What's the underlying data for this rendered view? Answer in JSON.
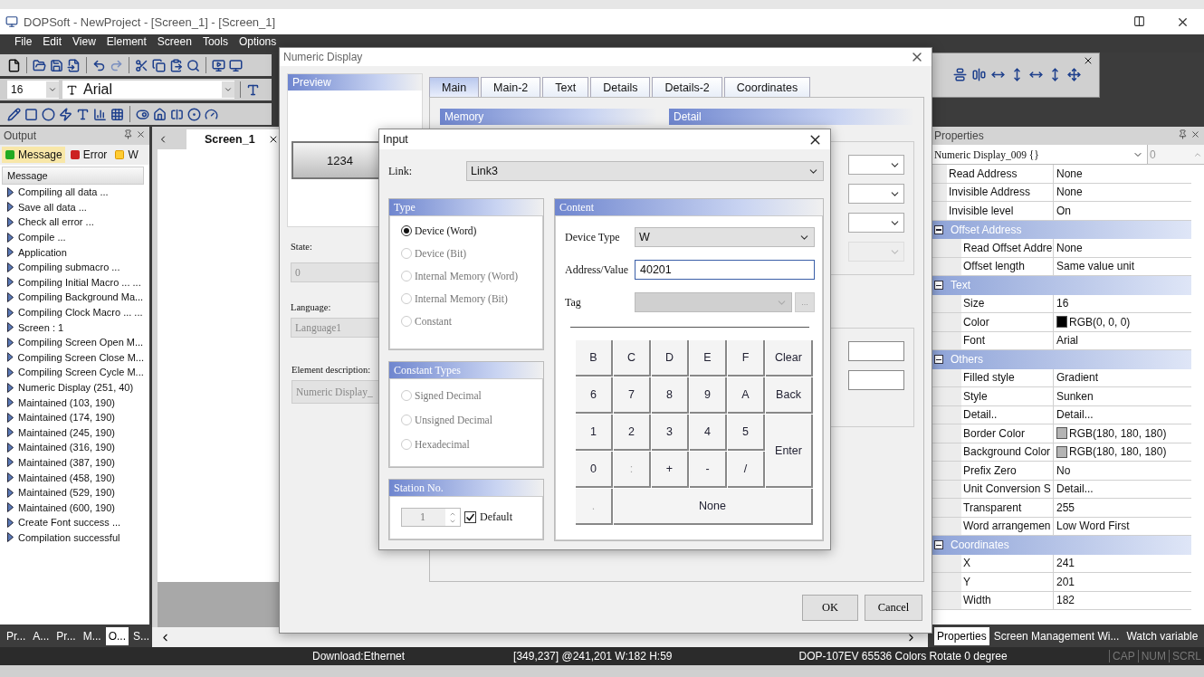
{
  "window": {
    "title": "DOPSoft - NewProject - [Screen_1] - [Screen_1]"
  },
  "menu": [
    "File",
    "Edit",
    "View",
    "Element",
    "Screen",
    "Tools",
    "Options"
  ],
  "font_toolbar": {
    "size": "16",
    "font": "Arial"
  },
  "output_panel": {
    "title": "Output",
    "tabs": [
      {
        "label": "Message",
        "selected": true
      },
      {
        "label": "Error",
        "selected": false
      },
      {
        "label": "W",
        "selected": false
      }
    ],
    "column": "Message",
    "messages": [
      "Compiling all data ...",
      "Save all data ...",
      "Check all error ...",
      "Compile ...",
      "Application",
      "Compiling submacro ...",
      "Compiling Initial Macro ... ...",
      "Compiling Background Ma...",
      "Compiling Clock Macro ... ...",
      "Screen : 1",
      "Compiling Screen Open M...",
      "Compiling Screen Close M...",
      "Compiling Screen Cycle M...",
      "Numeric Display (251, 40)",
      "Maintained (103, 190)",
      "Maintained (174, 190)",
      "Maintained (245, 190)",
      "Maintained (316, 190)",
      "Maintained (387, 190)",
      "Maintained (458, 190)",
      "Maintained (529, 190)",
      "Maintained (600, 190)",
      "Create Font success ...",
      "Compilation successful"
    ]
  },
  "left_tabs": [
    {
      "label": "Pr...",
      "selected": false
    },
    {
      "label": "A...",
      "selected": false
    },
    {
      "label": "Pr...",
      "selected": false
    },
    {
      "label": "M...",
      "selected": false
    },
    {
      "label": "O...",
      "selected": true
    },
    {
      "label": "S...",
      "selected": false
    }
  ],
  "editor": {
    "tab": "Screen_1"
  },
  "numeric_display_dialog": {
    "title": "Numeric Display",
    "preview_title": "Preview",
    "preview_value": "1234",
    "state": {
      "label": "State:",
      "value": "0",
      "disabled": true
    },
    "language": {
      "label": "Language:",
      "value": "Language1",
      "disabled": true
    },
    "description": {
      "label": "Element description:",
      "value": "Numeric Display_",
      "disabled": true
    },
    "tabs": [
      {
        "label": "Main",
        "selected": true
      },
      {
        "label": "Main-2",
        "selected": false
      },
      {
        "label": "Text",
        "selected": false
      },
      {
        "label": "Details",
        "selected": false
      },
      {
        "label": "Details-2",
        "selected": false
      },
      {
        "label": "Coordinates",
        "selected": false
      }
    ],
    "memory_title": "Memory",
    "detail_title": "Detail",
    "buttons": [
      "OK",
      "Cancel"
    ]
  },
  "input_dialog": {
    "title": "Input",
    "link": {
      "label": "Link:",
      "value": "Link3"
    },
    "type": {
      "title": "Type",
      "options": [
        {
          "label": "Device (Word)",
          "selected": true,
          "disabled": false
        },
        {
          "label": "Device (Bit)",
          "selected": false,
          "disabled": true
        },
        {
          "label": "Internal Memory (Word)",
          "selected": false,
          "disabled": true
        },
        {
          "label": "Internal Memory (Bit)",
          "selected": false,
          "disabled": true
        },
        {
          "label": "Constant",
          "selected": false,
          "disabled": true
        }
      ]
    },
    "constant_types": {
      "title": "Constant Types",
      "options": [
        {
          "label": "Signed Decimal",
          "selected": false,
          "disabled": true
        },
        {
          "label": "Unsigned Decimal",
          "selected": false,
          "disabled": true
        },
        {
          "label": "Hexadecimal",
          "selected": false,
          "disabled": true
        }
      ]
    },
    "station": {
      "title": "Station No.",
      "value": "1",
      "disabled": true,
      "default_label": "Default",
      "default_checked": true
    },
    "content": {
      "title": "Content",
      "device_type": {
        "label": "Device Type",
        "value": "W"
      },
      "address": {
        "label": "Address/Value",
        "value": "40201"
      },
      "tag": {
        "label": "Tag",
        "disabled": true,
        "browse": "..."
      },
      "keys": [
        {
          "label": "B",
          "kind": "normal",
          "disabled": false
        },
        {
          "label": "C",
          "kind": "normal",
          "disabled": false
        },
        {
          "label": "D",
          "kind": "normal",
          "disabled": false
        },
        {
          "label": "E",
          "kind": "normal",
          "disabled": false
        },
        {
          "label": "F",
          "kind": "normal",
          "disabled": false
        },
        {
          "label": "Clear",
          "kind": "normal",
          "disabled": false
        },
        {
          "label": "6",
          "kind": "normal",
          "disabled": false
        },
        {
          "label": "7",
          "kind": "normal",
          "disabled": false
        },
        {
          "label": "8",
          "kind": "normal",
          "disabled": false
        },
        {
          "label": "9",
          "kind": "normal",
          "disabled": false
        },
        {
          "label": "A",
          "kind": "normal",
          "disabled": false
        },
        {
          "label": "Back",
          "kind": "normal",
          "disabled": false
        },
        {
          "label": "1",
          "kind": "normal",
          "disabled": false
        },
        {
          "label": "2",
          "kind": "normal",
          "disabled": false
        },
        {
          "label": "3",
          "kind": "normal",
          "disabled": false
        },
        {
          "label": "4",
          "kind": "normal",
          "disabled": false
        },
        {
          "label": "5",
          "kind": "normal",
          "disabled": false
        },
        {
          "label": "Enter",
          "kind": "tall",
          "disabled": false
        },
        {
          "label": "0",
          "kind": "normal",
          "disabled": false
        },
        {
          "label": ":",
          "kind": "normal",
          "disabled": true
        },
        {
          "label": "+",
          "kind": "normal",
          "disabled": false
        },
        {
          "label": "-",
          "kind": "normal",
          "disabled": false
        },
        {
          "label": "/",
          "kind": "normal",
          "disabled": false
        },
        {
          "label": ".",
          "kind": "normal",
          "disabled": true
        },
        {
          "label": "None",
          "kind": "wide",
          "disabled": false
        }
      ]
    }
  },
  "properties": {
    "title": "Properties",
    "object": "Numeric Display_009 {}",
    "spin": "0",
    "rows": [
      {
        "name": "Read Address",
        "value": "None"
      },
      {
        "name": "Invisible Address",
        "value": "None"
      },
      {
        "name": "Invisible level",
        "value": "On"
      },
      {
        "name": "Offset Address",
        "expanded": true,
        "children": [
          {
            "name": "Read Offset Addre",
            "value": "None"
          },
          {
            "name": "Offset length",
            "value": "Same value unit"
          }
        ]
      },
      {
        "name": "Text",
        "expanded": true,
        "children": [
          {
            "name": "Size",
            "value": "16"
          },
          {
            "name": "Color",
            "value": "RGB(0, 0, 0)",
            "color": "#000000"
          },
          {
            "name": "Font",
            "value": "Arial"
          }
        ]
      },
      {
        "name": "Others",
        "expanded": true,
        "children": [
          {
            "name": "Filled style",
            "value": "Gradient"
          },
          {
            "name": "Style",
            "value": "Sunken"
          },
          {
            "name": "Detail..",
            "value": "Detail..."
          },
          {
            "name": "Border Color",
            "value": "RGB(180, 180, 180)",
            "color": "#b4b4b4"
          },
          {
            "name": "Background Color",
            "value": "RGB(180, 180, 180)",
            "color": "#b4b4b4"
          },
          {
            "name": "Prefix Zero",
            "value": "No"
          },
          {
            "name": "Unit Conversion S",
            "value": "Detail..."
          },
          {
            "name": "Transparent",
            "value": "255"
          },
          {
            "name": "Word arrangemen",
            "value": "Low Word First"
          }
        ]
      },
      {
        "name": "Coordinates",
        "expanded": true,
        "children": [
          {
            "name": "X",
            "value": "241"
          },
          {
            "name": "Y",
            "value": "201"
          },
          {
            "name": "Width",
            "value": "182"
          }
        ]
      }
    ]
  },
  "right_tabs": [
    {
      "label": "Properties",
      "selected": true
    },
    {
      "label": "Screen Management Wi...",
      "selected": false
    },
    {
      "label": "Watch variable",
      "selected": false
    }
  ],
  "status_bar": {
    "items": [
      "Download:Ethernet",
      "[349,237] @241,201 W:182 H:59",
      "DOP-107EV 65536 Colors Rotate 0 degree"
    ],
    "locks": [
      {
        "label": "CAP",
        "on": false
      },
      {
        "label": "NUM",
        "on": false
      },
      {
        "label": "SCRL",
        "on": false
      }
    ]
  }
}
